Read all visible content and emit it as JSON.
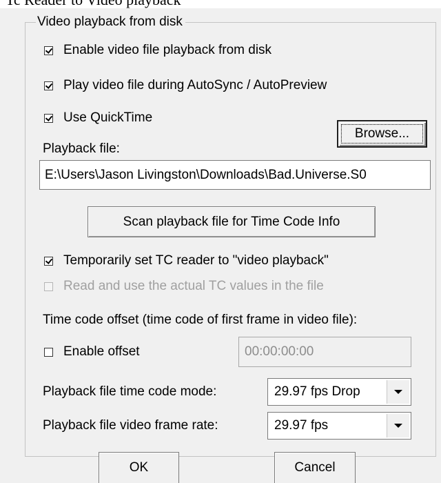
{
  "top_partial_text": "Tc Reader to Video playback",
  "group": {
    "title": "Video playback from disk"
  },
  "checkboxes": {
    "enable_playback": {
      "label": "Enable video file playback from disk",
      "checked": true
    },
    "play_during_autosync": {
      "label": "Play video file during AutoSync / AutoPreview",
      "checked": true
    },
    "use_quicktime": {
      "label": "Use QuickTime",
      "checked": true
    },
    "temp_set_tc_reader": {
      "label": "Temporarily set TC reader to \"video playback\"",
      "checked": true
    },
    "read_actual_tc": {
      "label": "Read and use the actual TC values in the file",
      "checked": false,
      "disabled": true
    },
    "enable_offset": {
      "label": "Enable offset",
      "checked": false
    }
  },
  "playback_file": {
    "label": "Playback file:",
    "value": "E:\\Users\\Jason Livingston\\Downloads\\Bad.Universe.S0",
    "browse_label": "Browse..."
  },
  "scan_button_label": "Scan playback file for Time Code Info",
  "time_code_offset": {
    "heading": "Time code offset (time code of first frame in video file):",
    "value": "00:00:00:00"
  },
  "time_code_mode": {
    "label": "Playback file time code mode:",
    "selected": "29.97 fps Drop"
  },
  "frame_rate": {
    "label": "Playback file video frame rate:",
    "selected": "29.97 fps"
  },
  "buttons": {
    "ok": "OK",
    "cancel": "Cancel"
  }
}
